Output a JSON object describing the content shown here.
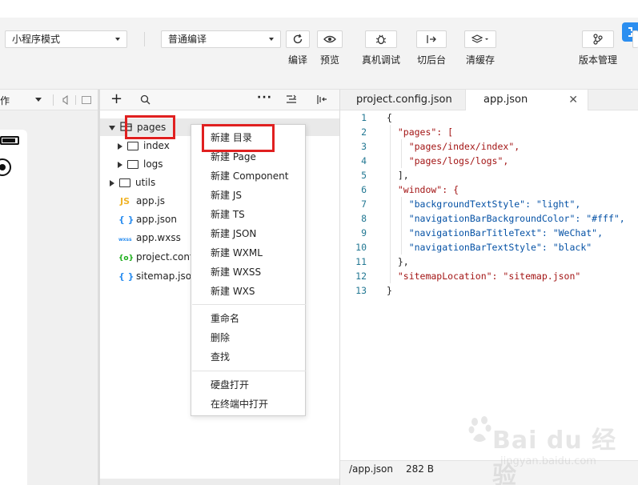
{
  "toolbar": {
    "mode_select": "小程序模式",
    "compile_select": "普通编译",
    "buttons": [
      {
        "label": "编译",
        "icon": "refresh-icon"
      },
      {
        "label": "预览",
        "icon": "eye-icon"
      },
      {
        "label": "真机调试",
        "icon": "bug-icon"
      },
      {
        "label": "切后台",
        "icon": "switch-background-icon"
      },
      {
        "label": "清缓存",
        "icon": "layers-icon"
      },
      {
        "label": "版本管理",
        "icon": "branch-icon"
      }
    ]
  },
  "simulator": {
    "header_text": "作"
  },
  "explorer": {
    "items": [
      {
        "name": "pages",
        "type": "folder",
        "expanded": true
      },
      {
        "name": "index",
        "type": "folder",
        "expanded": false
      },
      {
        "name": "logs",
        "type": "folder",
        "expanded": false
      },
      {
        "name": "utils",
        "type": "folder",
        "expanded": false
      },
      {
        "name": "app.js",
        "type": "js",
        "icon_text": "JS"
      },
      {
        "name": "app.json",
        "type": "json",
        "icon_text": "{ }"
      },
      {
        "name": "app.wxss",
        "type": "wxss",
        "icon_text": "wxss"
      },
      {
        "name": "project.confi",
        "type": "config",
        "icon_text": "{o}"
      },
      {
        "name": "sitemap.json",
        "type": "json",
        "icon_text": "{ }"
      }
    ]
  },
  "context_menu": {
    "groups": [
      [
        "新建 目录",
        "新建 Page",
        "新建 Component",
        "新建 JS",
        "新建 TS",
        "新建 JSON",
        "新建 WXML",
        "新建 WXSS",
        "新建 WXS"
      ],
      [
        "重命名",
        "删除",
        "查找"
      ],
      [
        "硬盘打开",
        "在终端中打开"
      ]
    ]
  },
  "editor": {
    "tabs": [
      "project.config.json",
      "app.json"
    ],
    "active_tab": "app.json",
    "lines": [
      "{",
      "  \"pages\": [",
      "    \"pages/index/index\",",
      "    \"pages/logs/logs\",",
      "  ],",
      "  \"window\": {",
      "    \"backgroundTextStyle\": \"light\",",
      "    \"navigationBarBackgroundColor\": \"#fff\",",
      "    \"navigationBarTitleText\": \"WeChat\",",
      "    \"navigationBarTextStyle\": \"black\"",
      "  },",
      "  \"sitemapLocation\": \"sitemap.json\"",
      "}"
    ]
  },
  "statusbar": {
    "path": "/app.json",
    "size": "282 B"
  },
  "watermark": {
    "brand": "Bai du 经验",
    "url": "jingyan.baidu.com"
  },
  "colors": {
    "highlight": "#e02020",
    "accent": "#2b8ef0",
    "key": "#a31515",
    "string": "#0451a5",
    "line_number": "#237893"
  }
}
